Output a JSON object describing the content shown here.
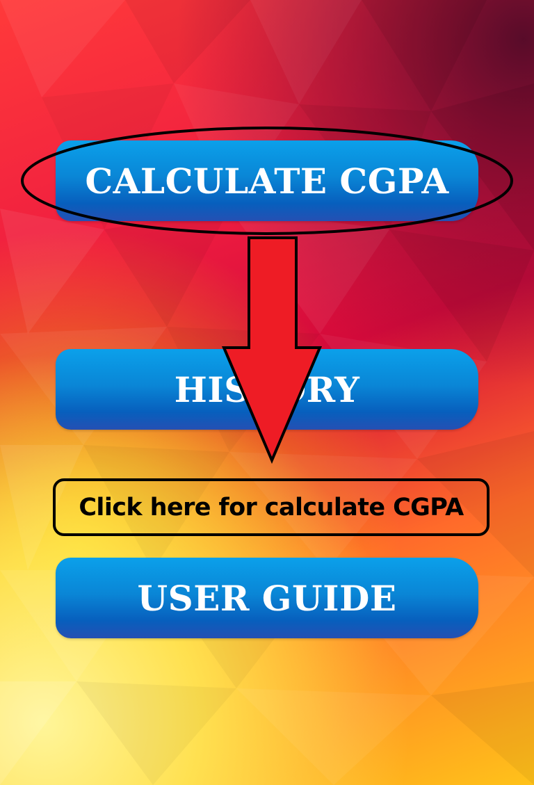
{
  "buttons": {
    "calculate": "CALCULATE CGPA",
    "history": "HISTORY",
    "user_guide": "USER GUIDE"
  },
  "annotation": {
    "callout_text": "Click here for calculate CGPA"
  },
  "colors": {
    "button_top": "#0ba0ea",
    "button_bottom": "#2550b3",
    "arrow_fill": "#ee1c25",
    "annotation_stroke": "#000000"
  }
}
